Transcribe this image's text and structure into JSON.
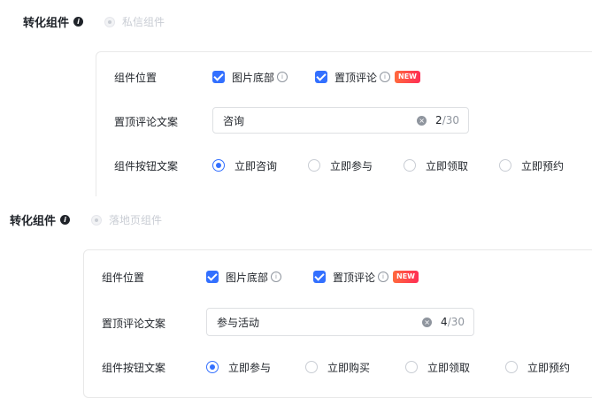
{
  "section1": {
    "conversion_title": "转化组件",
    "disabled_option": "私信组件",
    "position_label": "组件位置",
    "positions": [
      {
        "label": "图片底部",
        "checked": true
      },
      {
        "label": "置顶评论",
        "checked": true,
        "badge": "NEW"
      }
    ],
    "comment_label": "置顶评论文案",
    "comment_value": "咨询",
    "comment_count": "2",
    "comment_max": "/30",
    "button_label": "组件按钮文案",
    "button_options": [
      "立即咨询",
      "立即参与",
      "立即领取",
      "立即预约"
    ],
    "button_selected": "立即咨询"
  },
  "section2": {
    "conversion_title": "转化组件",
    "disabled_option": "落地页组件",
    "position_label": "组件位置",
    "positions": [
      {
        "label": "图片底部",
        "checked": true
      },
      {
        "label": "置顶评论",
        "checked": true,
        "badge": "NEW"
      }
    ],
    "comment_label": "置顶评论文案",
    "comment_value": "参与活动",
    "comment_count": "4",
    "comment_max": "/30",
    "button_label": "组件按钮文案",
    "button_options": [
      "立即参与",
      "立即购买",
      "立即领取",
      "立即预约"
    ],
    "button_selected": "立即参与"
  },
  "colors": {
    "accent": "#3370ff",
    "badge": "#ff2d55",
    "disabled": "#c9cdd4"
  }
}
